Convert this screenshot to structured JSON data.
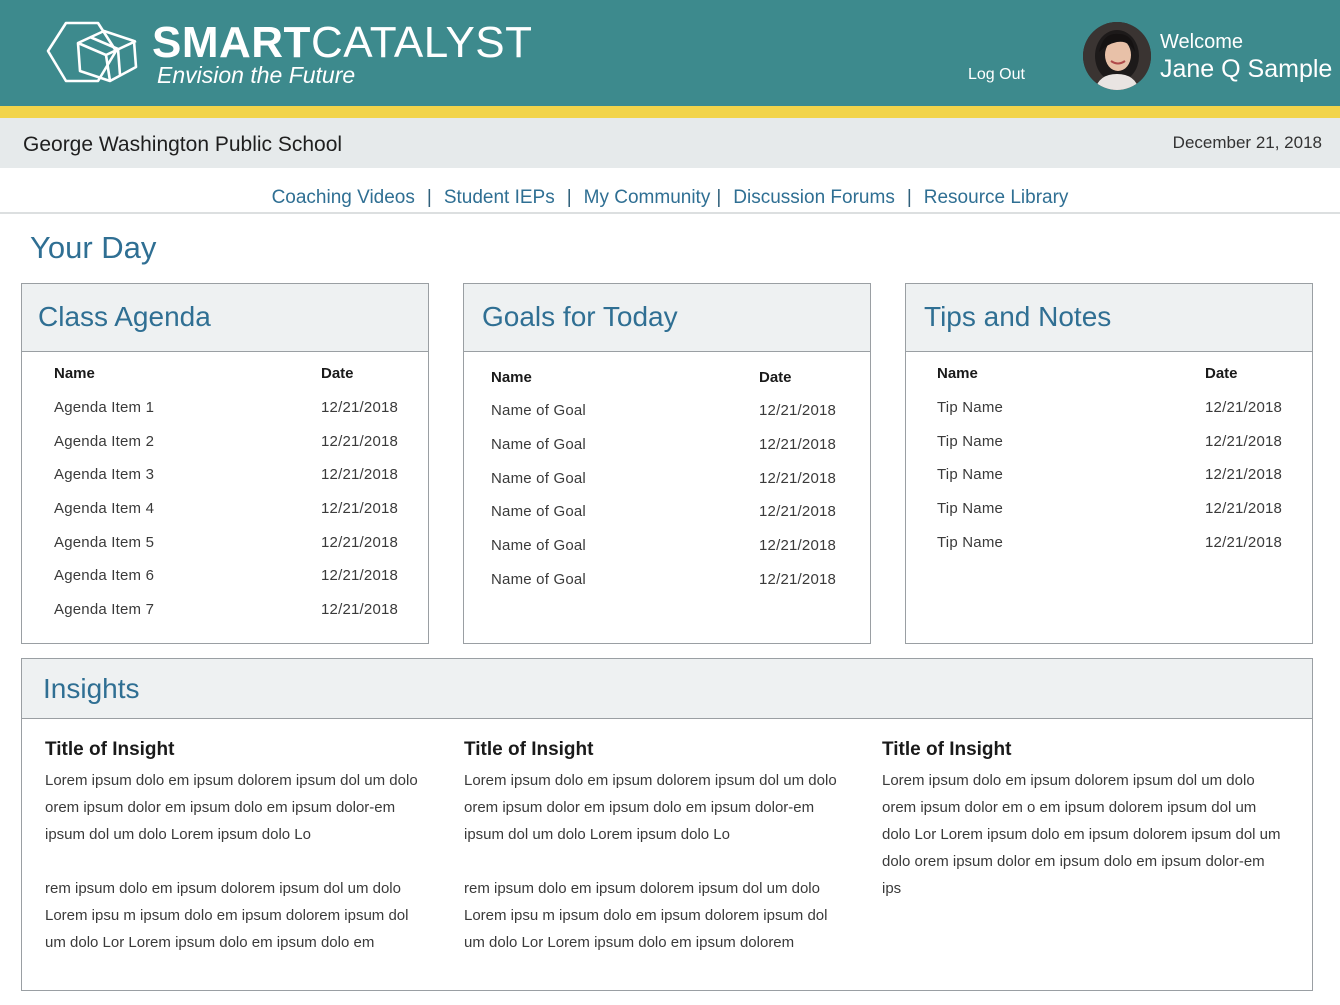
{
  "header": {
    "brand_bold": "SMART",
    "brand_light": "CATALYST",
    "tagline": "Envision the Future",
    "logout_label": "Log Out",
    "welcome": "Welcome",
    "username": "Jane Q Sample",
    "colors": {
      "header_bg": "#3d8a8d",
      "stripe": "#f2d44a"
    }
  },
  "school_bar": {
    "school_name": "George Washington Public School",
    "date": "December 21, 2018"
  },
  "nav": {
    "items": [
      "Coaching Videos",
      "Student IEPs",
      "My Community",
      "Discussion Forums",
      "Resource Library"
    ],
    "separator": "|"
  },
  "page_title": "Your Day",
  "class_agenda": {
    "title": "Class Agenda",
    "col_name": "Name",
    "col_date": "Date",
    "rows": [
      {
        "name": "Agenda Item 1",
        "date": "12/21/2018"
      },
      {
        "name": "Agenda Item 2",
        "date": "12/21/2018"
      },
      {
        "name": "Agenda Item 3",
        "date": "12/21/2018"
      },
      {
        "name": "Agenda Item 4",
        "date": "12/21/2018"
      },
      {
        "name": "Agenda Item 5",
        "date": "12/21/2018"
      },
      {
        "name": "Agenda Item 6",
        "date": "12/21/2018"
      },
      {
        "name": "Agenda Item 7",
        "date": "12/21/2018"
      }
    ]
  },
  "goals": {
    "title": "Goals for Today",
    "col_name": "Name",
    "col_date": "Date",
    "rows": [
      {
        "name": "Name of Goal",
        "date": "12/21/2018"
      },
      {
        "name": "Name of Goal",
        "date": "12/21/2018"
      },
      {
        "name": "Name of Goal",
        "date": "12/21/2018"
      },
      {
        "name": "Name of Goal",
        "date": "12/21/2018"
      },
      {
        "name": "Name of Goal",
        "date": "12/21/2018"
      },
      {
        "name": "Name of Goal",
        "date": "12/21/2018"
      }
    ]
  },
  "tips": {
    "title": "Tips and Notes",
    "col_name": "Name",
    "col_date": "Date",
    "rows": [
      {
        "name": "Tip Name",
        "date": "12/21/2018"
      },
      {
        "name": "Tip Name",
        "date": "12/21/2018"
      },
      {
        "name": "Tip Name",
        "date": "12/21/2018"
      },
      {
        "name": "Tip Name",
        "date": "12/21/2018"
      },
      {
        "name": "Tip Name",
        "date": "12/21/2018"
      }
    ]
  },
  "insights": {
    "title": "Insights",
    "items": [
      {
        "title": "Title of Insight",
        "p1": "Lorem ipsum dolo em ipsum dolorem ipsum dol um dolo  orem ipsum dolor em ipsum dolo em ipsum dolor-em ipsum dol um dolo Lorem ipsum dolo Lo",
        "p2": "rem ipsum dolo em ipsum dolorem ipsum dol um dolo Lorem ipsu m ipsum dolo em ipsum dolorem ipsum dol um dolo Lor  Lorem ipsum dolo em ipsum dolo em"
      },
      {
        "title": "Title of Insight",
        "p1": "Lorem ipsum dolo em ipsum dolorem ipsum dol um dolo  orem ipsum dolor em ipsum dolo em ipsum dolor-em ipsum dol um dolo Lorem ipsum dolo Lo",
        "p2": "rem ipsum dolo em ipsum dolorem ipsum dol um dolo Lorem ipsu m ipsum dolo em ipsum dolorem ipsum dol um dolo Lor  Lorem ipsum dolo em ipsum dolorem"
      },
      {
        "title": "Title of Insight",
        "p1": "Lorem ipsum dolo em ipsum dolorem ipsum dol um dolo orem ipsum dolor em o em ipsum dolorem ipsum dol um dolo Lor  Lorem ipsum dolo em ipsum dolorem ipsum dol um dolo  orem ipsum dolor em ipsum dolo em ipsum dolor-em ips",
        "p2": ""
      }
    ]
  }
}
